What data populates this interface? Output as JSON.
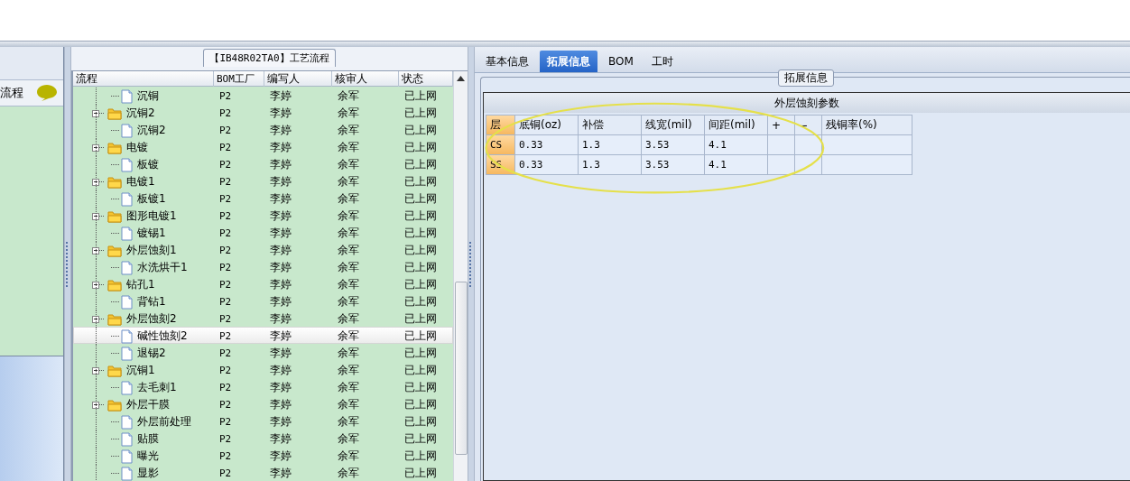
{
  "left_panel": {
    "title": "流程"
  },
  "process_group": {
    "title": "【IB48R02TA0】工艺流程",
    "columns": [
      "流程",
      "BOM工厂",
      "编写人",
      "核审人",
      "状态"
    ],
    "rows": [
      {
        "kind": "file",
        "label": "沉铜",
        "factory": "P2",
        "author": "李婷",
        "reviewer": "余军",
        "status": "已上网",
        "selected": false
      },
      {
        "kind": "folder",
        "label": "沉铜2",
        "factory": "P2",
        "author": "李婷",
        "reviewer": "余军",
        "status": "已上网",
        "selected": false,
        "children": [
          {
            "kind": "file",
            "label": "沉铜2",
            "factory": "P2",
            "author": "李婷",
            "reviewer": "余军",
            "status": "已上网",
            "selected": false
          }
        ]
      },
      {
        "kind": "folder",
        "label": "电镀",
        "factory": "P2",
        "author": "李婷",
        "reviewer": "余军",
        "status": "已上网",
        "selected": false,
        "children": [
          {
            "kind": "file",
            "label": "板镀",
            "factory": "P2",
            "author": "李婷",
            "reviewer": "余军",
            "status": "已上网",
            "selected": false
          }
        ]
      },
      {
        "kind": "folder",
        "label": "电镀1",
        "factory": "P2",
        "author": "李婷",
        "reviewer": "余军",
        "status": "已上网",
        "selected": false,
        "children": [
          {
            "kind": "file",
            "label": "板镀1",
            "factory": "P2",
            "author": "李婷",
            "reviewer": "余军",
            "status": "已上网",
            "selected": false
          }
        ]
      },
      {
        "kind": "folder",
        "label": "图形电镀1",
        "factory": "P2",
        "author": "李婷",
        "reviewer": "余军",
        "status": "已上网",
        "selected": false,
        "children": [
          {
            "kind": "file",
            "label": "镀锡1",
            "factory": "P2",
            "author": "李婷",
            "reviewer": "余军",
            "status": "已上网",
            "selected": false
          }
        ]
      },
      {
        "kind": "folder",
        "label": "外层蚀刻1",
        "factory": "P2",
        "author": "李婷",
        "reviewer": "余军",
        "status": "已上网",
        "selected": false,
        "children": [
          {
            "kind": "file",
            "label": "水洗烘干1",
            "factory": "P2",
            "author": "李婷",
            "reviewer": "余军",
            "status": "已上网",
            "selected": false
          }
        ]
      },
      {
        "kind": "folder",
        "label": "钻孔1",
        "factory": "P2",
        "author": "李婷",
        "reviewer": "余军",
        "status": "已上网",
        "selected": false,
        "children": [
          {
            "kind": "file",
            "label": "背钻1",
            "factory": "P2",
            "author": "李婷",
            "reviewer": "余军",
            "status": "已上网",
            "selected": false
          }
        ]
      },
      {
        "kind": "folder",
        "label": "外层蚀刻2",
        "factory": "P2",
        "author": "李婷",
        "reviewer": "余军",
        "status": "已上网",
        "selected": false,
        "children": [
          {
            "kind": "file",
            "label": "碱性蚀刻2",
            "factory": "P2",
            "author": "李婷",
            "reviewer": "余军",
            "status": "已上网",
            "selected": true
          },
          {
            "kind": "file",
            "label": "退锡2",
            "factory": "P2",
            "author": "李婷",
            "reviewer": "余军",
            "status": "已上网",
            "selected": false
          }
        ]
      },
      {
        "kind": "folder",
        "label": "沉铜1",
        "factory": "P2",
        "author": "李婷",
        "reviewer": "余军",
        "status": "已上网",
        "selected": false,
        "children": [
          {
            "kind": "file",
            "label": "去毛刺1",
            "factory": "P2",
            "author": "李婷",
            "reviewer": "余军",
            "status": "已上网",
            "selected": false
          }
        ]
      },
      {
        "kind": "folder",
        "label": "外层干膜",
        "factory": "P2",
        "author": "李婷",
        "reviewer": "余军",
        "status": "已上网",
        "selected": false,
        "children": [
          {
            "kind": "file",
            "label": "外层前处理",
            "factory": "P2",
            "author": "李婷",
            "reviewer": "余军",
            "status": "已上网",
            "selected": false
          },
          {
            "kind": "file",
            "label": "贴膜",
            "factory": "P2",
            "author": "李婷",
            "reviewer": "余军",
            "status": "已上网",
            "selected": false
          },
          {
            "kind": "file",
            "label": "曝光",
            "factory": "P2",
            "author": "李婷",
            "reviewer": "余军",
            "status": "已上网",
            "selected": false
          },
          {
            "kind": "file",
            "label": "显影",
            "factory": "P2",
            "author": "李婷",
            "reviewer": "余军",
            "status": "已上网",
            "selected": false
          }
        ]
      }
    ]
  },
  "tabs": [
    {
      "label": "基本信息",
      "selected": false
    },
    {
      "label": "拓展信息",
      "selected": true
    },
    {
      "label": "BOM",
      "selected": false
    },
    {
      "label": "工时",
      "selected": false
    }
  ],
  "detail_group": {
    "title": "拓展信息",
    "panel_title": "外层蚀刻参数",
    "columns": [
      "层",
      "底铜(oz)",
      "补偿",
      "线宽(mil)",
      "间距(mil)",
      "+",
      "−",
      "残铜率(%)"
    ],
    "rows": [
      [
        "CS",
        "0.33",
        "1.3",
        "3.53",
        "4.1"
      ],
      [
        "SS",
        "0.33",
        "1.3",
        "3.53",
        "4.1"
      ]
    ]
  }
}
